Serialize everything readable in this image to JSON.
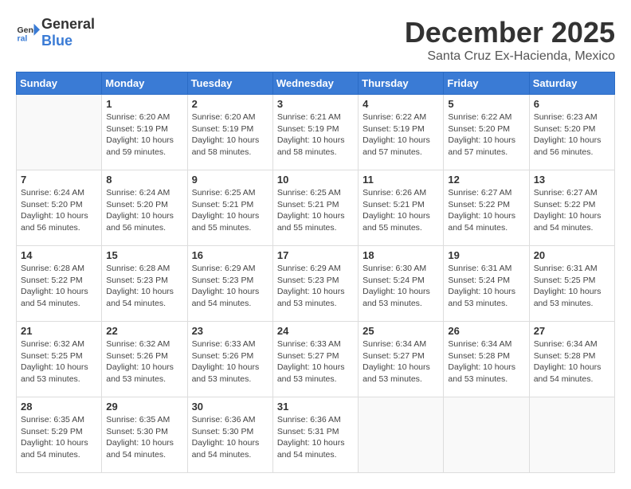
{
  "header": {
    "logo_general": "General",
    "logo_blue": "Blue",
    "month": "December 2025",
    "location": "Santa Cruz Ex-Hacienda, Mexico"
  },
  "weekdays": [
    "Sunday",
    "Monday",
    "Tuesday",
    "Wednesday",
    "Thursday",
    "Friday",
    "Saturday"
  ],
  "weeks": [
    [
      {
        "day": "",
        "info": ""
      },
      {
        "day": "1",
        "info": "Sunrise: 6:20 AM\nSunset: 5:19 PM\nDaylight: 10 hours\nand 59 minutes."
      },
      {
        "day": "2",
        "info": "Sunrise: 6:20 AM\nSunset: 5:19 PM\nDaylight: 10 hours\nand 58 minutes."
      },
      {
        "day": "3",
        "info": "Sunrise: 6:21 AM\nSunset: 5:19 PM\nDaylight: 10 hours\nand 58 minutes."
      },
      {
        "day": "4",
        "info": "Sunrise: 6:22 AM\nSunset: 5:19 PM\nDaylight: 10 hours\nand 57 minutes."
      },
      {
        "day": "5",
        "info": "Sunrise: 6:22 AM\nSunset: 5:20 PM\nDaylight: 10 hours\nand 57 minutes."
      },
      {
        "day": "6",
        "info": "Sunrise: 6:23 AM\nSunset: 5:20 PM\nDaylight: 10 hours\nand 56 minutes."
      }
    ],
    [
      {
        "day": "7",
        "info": "Sunrise: 6:24 AM\nSunset: 5:20 PM\nDaylight: 10 hours\nand 56 minutes."
      },
      {
        "day": "8",
        "info": "Sunrise: 6:24 AM\nSunset: 5:20 PM\nDaylight: 10 hours\nand 56 minutes."
      },
      {
        "day": "9",
        "info": "Sunrise: 6:25 AM\nSunset: 5:21 PM\nDaylight: 10 hours\nand 55 minutes."
      },
      {
        "day": "10",
        "info": "Sunrise: 6:25 AM\nSunset: 5:21 PM\nDaylight: 10 hours\nand 55 minutes."
      },
      {
        "day": "11",
        "info": "Sunrise: 6:26 AM\nSunset: 5:21 PM\nDaylight: 10 hours\nand 55 minutes."
      },
      {
        "day": "12",
        "info": "Sunrise: 6:27 AM\nSunset: 5:22 PM\nDaylight: 10 hours\nand 54 minutes."
      },
      {
        "day": "13",
        "info": "Sunrise: 6:27 AM\nSunset: 5:22 PM\nDaylight: 10 hours\nand 54 minutes."
      }
    ],
    [
      {
        "day": "14",
        "info": "Sunrise: 6:28 AM\nSunset: 5:22 PM\nDaylight: 10 hours\nand 54 minutes."
      },
      {
        "day": "15",
        "info": "Sunrise: 6:28 AM\nSunset: 5:23 PM\nDaylight: 10 hours\nand 54 minutes."
      },
      {
        "day": "16",
        "info": "Sunrise: 6:29 AM\nSunset: 5:23 PM\nDaylight: 10 hours\nand 54 minutes."
      },
      {
        "day": "17",
        "info": "Sunrise: 6:29 AM\nSunset: 5:23 PM\nDaylight: 10 hours\nand 53 minutes."
      },
      {
        "day": "18",
        "info": "Sunrise: 6:30 AM\nSunset: 5:24 PM\nDaylight: 10 hours\nand 53 minutes."
      },
      {
        "day": "19",
        "info": "Sunrise: 6:31 AM\nSunset: 5:24 PM\nDaylight: 10 hours\nand 53 minutes."
      },
      {
        "day": "20",
        "info": "Sunrise: 6:31 AM\nSunset: 5:25 PM\nDaylight: 10 hours\nand 53 minutes."
      }
    ],
    [
      {
        "day": "21",
        "info": "Sunrise: 6:32 AM\nSunset: 5:25 PM\nDaylight: 10 hours\nand 53 minutes."
      },
      {
        "day": "22",
        "info": "Sunrise: 6:32 AM\nSunset: 5:26 PM\nDaylight: 10 hours\nand 53 minutes."
      },
      {
        "day": "23",
        "info": "Sunrise: 6:33 AM\nSunset: 5:26 PM\nDaylight: 10 hours\nand 53 minutes."
      },
      {
        "day": "24",
        "info": "Sunrise: 6:33 AM\nSunset: 5:27 PM\nDaylight: 10 hours\nand 53 minutes."
      },
      {
        "day": "25",
        "info": "Sunrise: 6:34 AM\nSunset: 5:27 PM\nDaylight: 10 hours\nand 53 minutes."
      },
      {
        "day": "26",
        "info": "Sunrise: 6:34 AM\nSunset: 5:28 PM\nDaylight: 10 hours\nand 53 minutes."
      },
      {
        "day": "27",
        "info": "Sunrise: 6:34 AM\nSunset: 5:28 PM\nDaylight: 10 hours\nand 54 minutes."
      }
    ],
    [
      {
        "day": "28",
        "info": "Sunrise: 6:35 AM\nSunset: 5:29 PM\nDaylight: 10 hours\nand 54 minutes."
      },
      {
        "day": "29",
        "info": "Sunrise: 6:35 AM\nSunset: 5:30 PM\nDaylight: 10 hours\nand 54 minutes."
      },
      {
        "day": "30",
        "info": "Sunrise: 6:36 AM\nSunset: 5:30 PM\nDaylight: 10 hours\nand 54 minutes."
      },
      {
        "day": "31",
        "info": "Sunrise: 6:36 AM\nSunset: 5:31 PM\nDaylight: 10 hours\nand 54 minutes."
      },
      {
        "day": "",
        "info": ""
      },
      {
        "day": "",
        "info": ""
      },
      {
        "day": "",
        "info": ""
      }
    ]
  ]
}
